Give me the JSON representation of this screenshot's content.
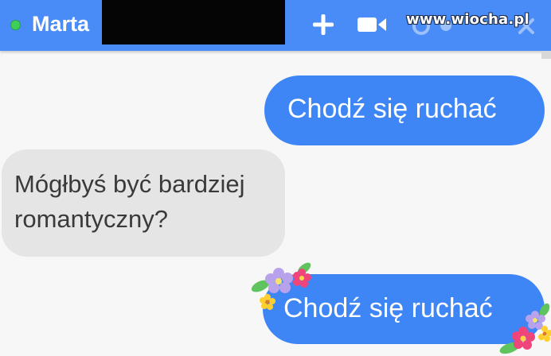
{
  "header": {
    "contact_name": "Marta",
    "status": "online",
    "watermark": "www.wiocha.pl",
    "icons": [
      "plus-icon",
      "video-icon",
      "call-icon",
      "close-icon"
    ]
  },
  "messages": [
    {
      "direction": "outgoing",
      "text": "Chodź się ruchać"
    },
    {
      "direction": "incoming",
      "text": "Mógłbyś być bardziej romantyczny?"
    },
    {
      "direction": "outgoing",
      "text": "Chodź się ruchać",
      "decoration": "flowers"
    }
  ],
  "colors": {
    "header": "#4a8cf7",
    "outgoing_bubble": "#3e86f5",
    "incoming_bubble": "#e5e5e6",
    "online": "#3fce5a"
  }
}
